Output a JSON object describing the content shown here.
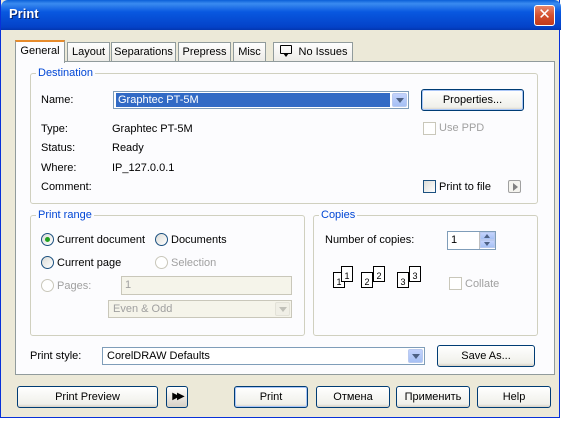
{
  "window": {
    "title": "Print"
  },
  "tabs": [
    {
      "label": "General",
      "active": true
    },
    {
      "label": "Layout"
    },
    {
      "label": "Separations"
    },
    {
      "label": "Prepress"
    },
    {
      "label": "Misc"
    },
    {
      "label": "No Issues",
      "icon": "issues-icon"
    }
  ],
  "destination": {
    "legend": "Destination",
    "name_label": "Name:",
    "name_value": "Graphtec PT-5M",
    "properties_label": "Properties...",
    "type_label": "Type:",
    "type_value": "Graphtec PT-5M",
    "status_label": "Status:",
    "status_value": "Ready",
    "where_label": "Where:",
    "where_value": "IP_127.0.0.1",
    "comment_label": "Comment:",
    "use_ppd_label": "Use PPD",
    "print_to_file_label": "Print to file"
  },
  "print_range": {
    "legend": "Print range",
    "current_document": "Current document",
    "documents": "Documents",
    "current_page": "Current page",
    "selection": "Selection",
    "pages_label": "Pages:",
    "pages_value": "1",
    "even_odd_value": "Even & Odd"
  },
  "copies": {
    "legend": "Copies",
    "number_label": "Number of copies:",
    "number_value": "1",
    "collate_label": "Collate",
    "preview_pages": [
      "1",
      "1",
      "2",
      "2",
      "3",
      "3"
    ]
  },
  "print_style": {
    "label": "Print style:",
    "value": "CorelDRAW Defaults",
    "save_as_label": "Save As..."
  },
  "footer": {
    "print_preview": "Print Preview",
    "print": "Print",
    "cancel": "Отмена",
    "apply": "Применить",
    "help": "Help"
  }
}
